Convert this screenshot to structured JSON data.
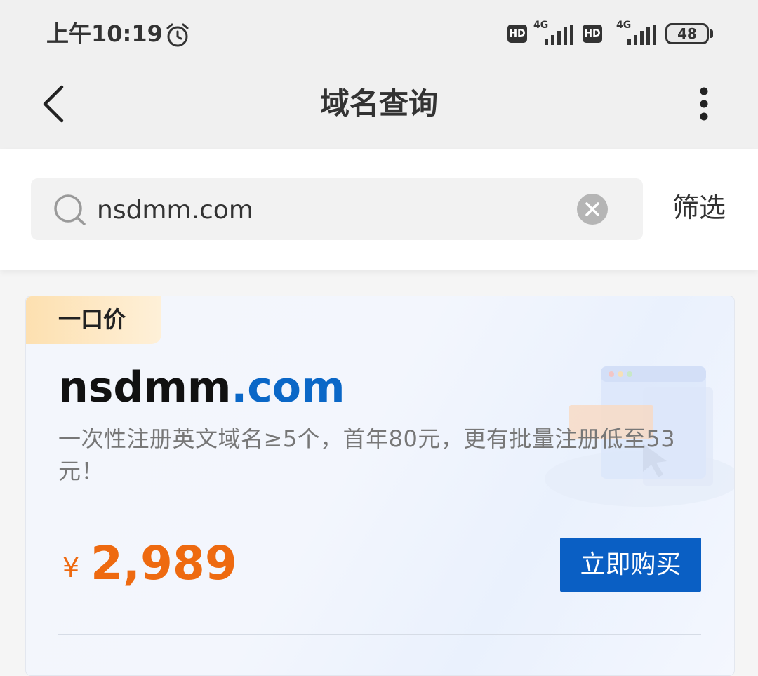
{
  "status_bar": {
    "time": "上午10:19",
    "hd_badge": "HD",
    "signal_label": "4G",
    "battery_level": "48"
  },
  "title_bar": {
    "title": "域名查询"
  },
  "search": {
    "query": "nsdmm.com",
    "filter_label": "筛选"
  },
  "result": {
    "price_type": "一口价",
    "domain_base": "nsdmm",
    "domain_suffix": ".com",
    "promo_text": "一次性注册英文域名≥5个，首年80元，更有批量注册低至53元！",
    "currency": "¥",
    "price": "2,989",
    "buy_label": "立即购买"
  },
  "colors": {
    "accent_blue": "#0a5fc4",
    "price_orange": "#ee6a10",
    "tag_gradient_start": "#fde0b0"
  }
}
